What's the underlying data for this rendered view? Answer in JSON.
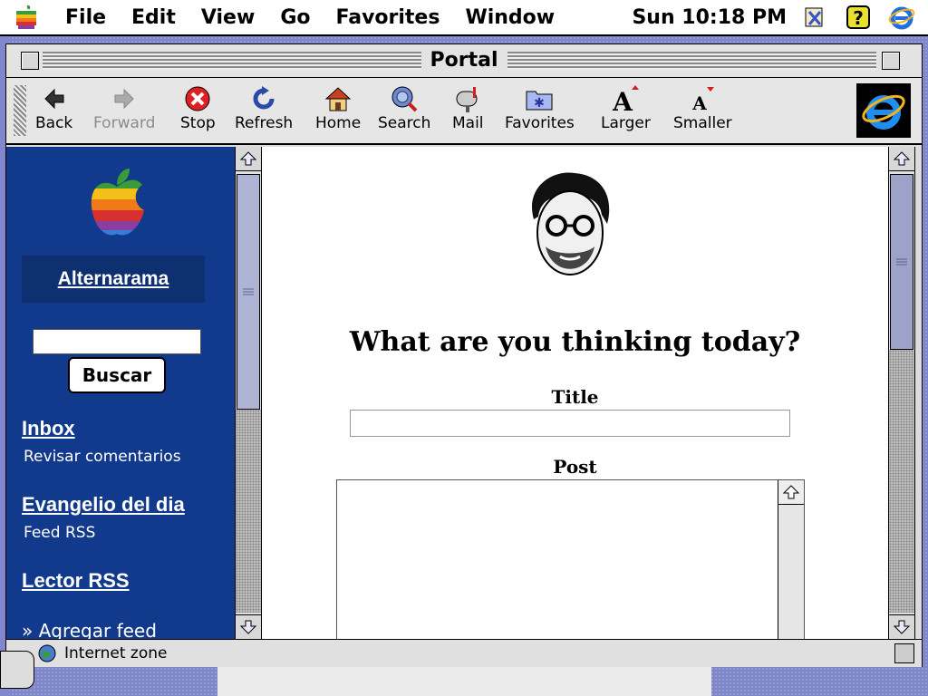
{
  "menubar": {
    "items": [
      "File",
      "Edit",
      "View",
      "Go",
      "Favorites",
      "Window"
    ],
    "clock": "Sun 10:18 PM",
    "tray_icons": [
      "control-strip-icon",
      "help-icon",
      "internet-explorer-icon"
    ]
  },
  "window": {
    "title": "Portal"
  },
  "toolbar": {
    "back": "Back",
    "forward": "Forward",
    "stop": "Stop",
    "refresh": "Refresh",
    "home": "Home",
    "search": "Search",
    "mail": "Mail",
    "favorites": "Favorites",
    "larger": "Larger",
    "smaller": "Smaller"
  },
  "sidebar": {
    "site_name": "Alternarama",
    "search_value": "",
    "search_button": "Buscar",
    "links": [
      {
        "label": "Inbox",
        "sub": "Revisar comentarios"
      },
      {
        "label": "Evangelio del dia",
        "sub": "Feed RSS"
      },
      {
        "label": "Lector RSS",
        "sub": ""
      }
    ],
    "add_feed": "» Agregar feed"
  },
  "content": {
    "heading": "What are you thinking today?",
    "title_label": "Title",
    "title_value": "",
    "post_label": "Post",
    "post_value": ""
  },
  "status": {
    "zone": "Internet zone"
  },
  "colors": {
    "sidebar_bg": "#123a8c",
    "desktop": "#7f86c8",
    "ie_blue": "#1f6fe0",
    "stop_red": "#e02020"
  }
}
